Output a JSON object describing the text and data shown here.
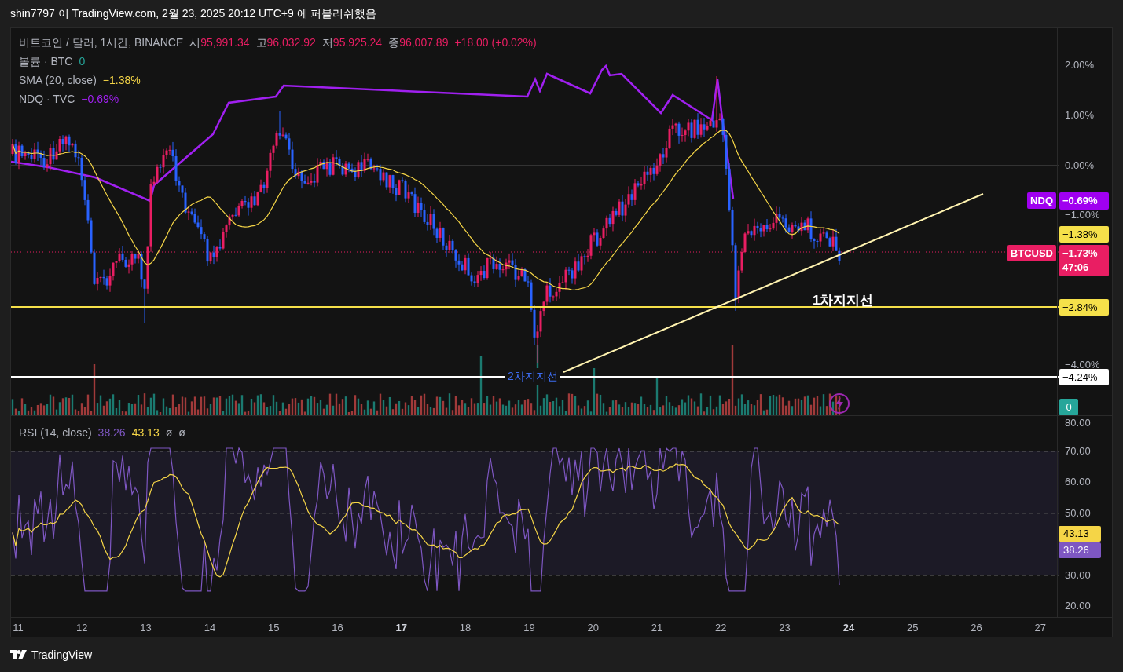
{
  "header": {
    "text": "shin7797 이 TradingView.com, 2월 23, 2025 20:12 UTC+9 에 퍼블리쉬했음"
  },
  "legend": {
    "symbol": "비트코인 / 달러, 1시간, BINANCE",
    "ohlc": [
      {
        "label": "시",
        "value": "95,991.34"
      },
      {
        "label": "고",
        "value": "96,032.92"
      },
      {
        "label": "저",
        "value": "95,925.24"
      },
      {
        "label": "종",
        "value": "96,007.89"
      }
    ],
    "change": "+18.00 (+0.02%)",
    "studies": [
      {
        "name": "볼륨 · BTC",
        "value": "0",
        "color": "#26a69a"
      },
      {
        "name": "SMA (20, close)",
        "value": "−1.38%",
        "color": "#f5d547"
      },
      {
        "name": "NDQ · TVC",
        "value": "−0.69%",
        "color": "#a020f0"
      }
    ]
  },
  "price_axis": {
    "labels": [
      "2.00%",
      "1.00%",
      "0.00%",
      "−1.00%",
      "−4.00%"
    ]
  },
  "price_badges": [
    {
      "kind": "pair",
      "name": "NDQ",
      "value": "−0.69%",
      "color": "#a000f0"
    },
    {
      "kind": "value",
      "value": "−1.38%",
      "color": "#f5e04a"
    },
    {
      "kind": "pair",
      "name": "BTCUSD",
      "value": "−1.73%",
      "countdown": "47:06",
      "color": "#e91e63"
    },
    {
      "kind": "value",
      "value": "−2.84%",
      "color": "#f5e04a"
    },
    {
      "kind": "value",
      "value": "−4.24%",
      "color": "#ffffff"
    },
    {
      "kind": "value",
      "value": "0",
      "color": "#26a69a"
    }
  ],
  "annotations": [
    {
      "text": "1차지지선"
    },
    {
      "text": "2차지지선"
    }
  ],
  "rsi": {
    "title": "RSI (14, close)",
    "values": [
      {
        "value": "38.26",
        "color": "#7e57c2"
      },
      {
        "value": "43.13",
        "color": "#f5d547"
      }
    ],
    "extras": [
      "ø",
      "ø"
    ],
    "axis_labels": [
      "80.00",
      "70.00",
      "60.00",
      "50.00",
      "30.00",
      "20.00"
    ],
    "badges": [
      {
        "value": "43.13",
        "color": "#f5d547"
      },
      {
        "value": "38.26",
        "color": "#7e57c2"
      }
    ]
  },
  "time_axis": [
    {
      "label": "11",
      "emphasized": false
    },
    {
      "label": "12",
      "emphasized": false
    },
    {
      "label": "13",
      "emphasized": false
    },
    {
      "label": "14",
      "emphasized": false
    },
    {
      "label": "15",
      "emphasized": false
    },
    {
      "label": "16",
      "emphasized": false
    },
    {
      "label": "17",
      "emphasized": true
    },
    {
      "label": "18",
      "emphasized": false
    },
    {
      "label": "19",
      "emphasized": false
    },
    {
      "label": "20",
      "emphasized": false
    },
    {
      "label": "21",
      "emphasized": false
    },
    {
      "label": "22",
      "emphasized": false
    },
    {
      "label": "23",
      "emphasized": false
    },
    {
      "label": "24",
      "emphasized": true
    },
    {
      "label": "25",
      "emphasized": false
    },
    {
      "label": "26",
      "emphasized": false
    },
    {
      "label": "27",
      "emphasized": false
    }
  ],
  "footer": {
    "brand": "TradingView"
  }
}
